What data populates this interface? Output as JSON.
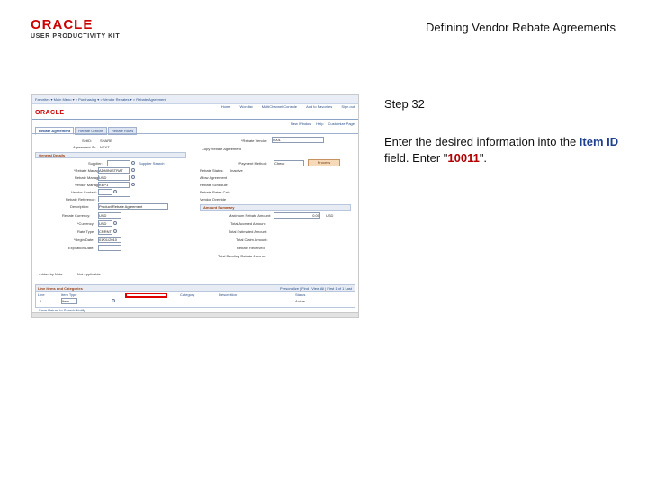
{
  "header": {
    "brand_name": "ORACLE",
    "brand_subtitle": "USER PRODUCTIVITY KIT",
    "document_title": "Defining Vendor Rebate Agreements"
  },
  "instructions": {
    "step_label": "Step 32",
    "text_before": "Enter the desired information into the ",
    "field_name": "Item ID",
    "text_middle": " field. Enter \"",
    "value": "10011",
    "text_after": "\"."
  },
  "app": {
    "breadcrumb": "Favorites ▾  Main Menu ▾  > Purchasing ▾ > Vendor Rebates ▾ > Rebate Agreement",
    "nav_links": [
      "Home",
      "Worklist",
      "MultiChannel Console",
      "Add to Favorites",
      "Sign out"
    ],
    "logo": "ORACLE",
    "header_links": [
      "New Window",
      "Help",
      "Customize Page"
    ],
    "tabs": [
      "Rebate Agreement",
      "Rebate Options",
      "Rebate Rules"
    ],
    "fields": {
      "setid_label": "SetID:",
      "setid_value": "SHARE",
      "agreement_label": "Agreement ID:",
      "agreement_value": "NEXT",
      "default_vendor_label": "*Rebate Vendor:",
      "default_vendor_value": "0001",
      "copy_label": "Copy Rebate Agreement"
    },
    "general_details": {
      "title": "General Details",
      "supplier_label": "Supplier:",
      "supplier_search": "Supplier Search",
      "manager_label": "*Rebate Manager:",
      "manager_value": "ADMINISTRAT",
      "currency_label": "Rebate Manager:",
      "currency_value": "USD",
      "vendor_label": "Vendor Manager:",
      "vendor_value": "KEP1",
      "vendor_contact_label": "Vendor Contact:",
      "reference_label": "Rebate Reference:",
      "description_label": "Description:",
      "description_value": "Product Rebate Agreement",
      "rebate_currency_label": "Rebate Currency:",
      "rebate_currency_value": "USD",
      "currency2_label": "*Currency:",
      "currency2_value": "USD",
      "rate_type_label": "Rate Type:",
      "rate_type_value": "CRRNT",
      "begin_date_label": "*Begin Date:",
      "begin_date_value": "01/01/2010",
      "expiration_label": "Expiration Date:"
    },
    "right_panel": {
      "payment_method_label": "*Payment Method:",
      "payment_method_value": "Check",
      "process_label": "Process",
      "status_label": "Rebate Status:",
      "status_value": "Inactive",
      "allow_label": "Allow Agreement",
      "schedule_label": "Rebate Schedule",
      "calc_label": "Rebate Rates Calc",
      "override_label": "Vendor Override",
      "summary_title": "Amount Summary",
      "threshold_label": "Maximum Rebate Amount:",
      "threshold_value": "0.00",
      "threshold_currency": "USD",
      "accrued_label": "Total Accrued Amount:",
      "estimated_label": "Total Estimated Amount:",
      "claim_label": "Total Claim Amount:",
      "received_label": "Rebate Received:",
      "pending_label": "Total Pending Rebate Amount:"
    },
    "meta": {
      "added_label": "Added by Note",
      "added_value": "Not Applicable"
    },
    "grid": {
      "title": "Line Items and Categories",
      "nav": "Personalize | Find | View All | First  1 of 1  Last",
      "columns": [
        "Line",
        "Item Type",
        "Item ID",
        "Category",
        "Description",
        "Status"
      ],
      "row_line": "1",
      "row_type": "Item",
      "row_status": "Active"
    },
    "footer": "Save   Return to Search   Notify"
  }
}
